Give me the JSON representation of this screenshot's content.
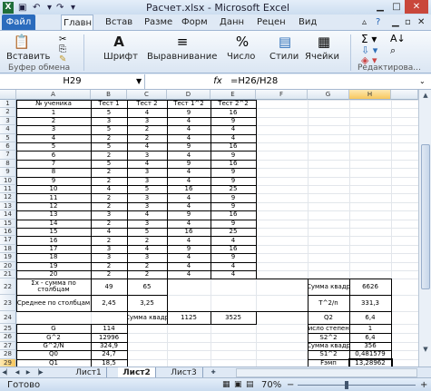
{
  "window": {
    "title": "Расчет.xlsx - Microsoft Excel"
  },
  "tabs": [
    "Файл",
    "Главн",
    "Встав",
    "Разме",
    "Форм",
    "Данн",
    "Рецен",
    "Вид"
  ],
  "ribbon": {
    "paste": "Вставить",
    "clipboard": "Буфер обмена",
    "font": "Шрифт",
    "alignment": "Выравнивание",
    "number": "Число",
    "styles": "Стили",
    "cells": "Ячейки",
    "editing": "Редактирова..."
  },
  "formula_bar": {
    "name_box": "H29",
    "fx": "fx",
    "formula": "=H26/H28"
  },
  "columns": [
    "A",
    "B",
    "C",
    "D",
    "E",
    "F",
    "G",
    "H"
  ],
  "rows": [
    "1",
    "2",
    "3",
    "4",
    "5",
    "6",
    "7",
    "8",
    "9",
    "10",
    "11",
    "12",
    "13",
    "14",
    "15",
    "16",
    "17",
    "18",
    "19",
    "20",
    "21",
    "22",
    "23",
    "24",
    "25",
    "26",
    "27",
    "28",
    "29",
    "30"
  ],
  "table": {
    "headers": [
      "№ ученика",
      "Тест 1",
      "Тест 2",
      "Тест 1^2",
      "Тест 2^2"
    ],
    "rows": [
      [
        "1",
        "5",
        "4",
        "9",
        "16"
      ],
      [
        "2",
        "3",
        "3",
        "4",
        "9"
      ],
      [
        "3",
        "5",
        "2",
        "4",
        "4"
      ],
      [
        "4",
        "2",
        "2",
        "4",
        "4"
      ],
      [
        "5",
        "5",
        "4",
        "9",
        "16"
      ],
      [
        "6",
        "2",
        "3",
        "4",
        "9"
      ],
      [
        "7",
        "5",
        "4",
        "9",
        "16"
      ],
      [
        "8",
        "2",
        "3",
        "4",
        "9"
      ],
      [
        "9",
        "2",
        "3",
        "4",
        "9"
      ],
      [
        "10",
        "4",
        "5",
        "16",
        "25"
      ],
      [
        "11",
        "2",
        "3",
        "4",
        "9"
      ],
      [
        "12",
        "2",
        "3",
        "4",
        "9"
      ],
      [
        "13",
        "3",
        "4",
        "9",
        "16"
      ],
      [
        "14",
        "2",
        "3",
        "4",
        "9"
      ],
      [
        "15",
        "4",
        "5",
        "16",
        "25"
      ],
      [
        "16",
        "2",
        "2",
        "4",
        "4"
      ],
      [
        "17",
        "3",
        "4",
        "9",
        "16"
      ],
      [
        "18",
        "3",
        "3",
        "4",
        "9"
      ],
      [
        "19",
        "2",
        "2",
        "4",
        "4"
      ],
      [
        "20",
        "2",
        "2",
        "4",
        "4"
      ]
    ]
  },
  "summary": {
    "a22": "Σx - сумма по столбцам",
    "b22": "49",
    "c22": "65",
    "a23": "Среднее по столбцам",
    "b23": "2,45",
    "c23": "3,25",
    "c24": "Сумма квадр",
    "d24": "1125",
    "e24": "3525",
    "a25": "G",
    "b25": "114",
    "a26": "G^2",
    "b26": "12996",
    "a27": "G^2/N",
    "b27": "324,9",
    "a28": "Q0",
    "b28": "24,7",
    "a29": "Q1",
    "b29": "18,5",
    "a30": "Число степеней",
    "b30": "38"
  },
  "right": {
    "g22": "Сумма квадр",
    "h22": "6626",
    "g23": "T^2/n",
    "h23": "331,3",
    "g24": "Q2",
    "h24": "6,4",
    "g25": "Число степене",
    "h25": "1",
    "g26": "S2^2",
    "h26": "6,4",
    "g27": "Сумма квадр",
    "h27": "356",
    "g28": "S1^2",
    "h28": "0,481579",
    "g29": "Fэмп",
    "h29": "13,28962"
  },
  "sheets": [
    "Лист1",
    "Лист2",
    "Лист3"
  ],
  "status": {
    "ready": "Готово",
    "zoom": "70%"
  }
}
